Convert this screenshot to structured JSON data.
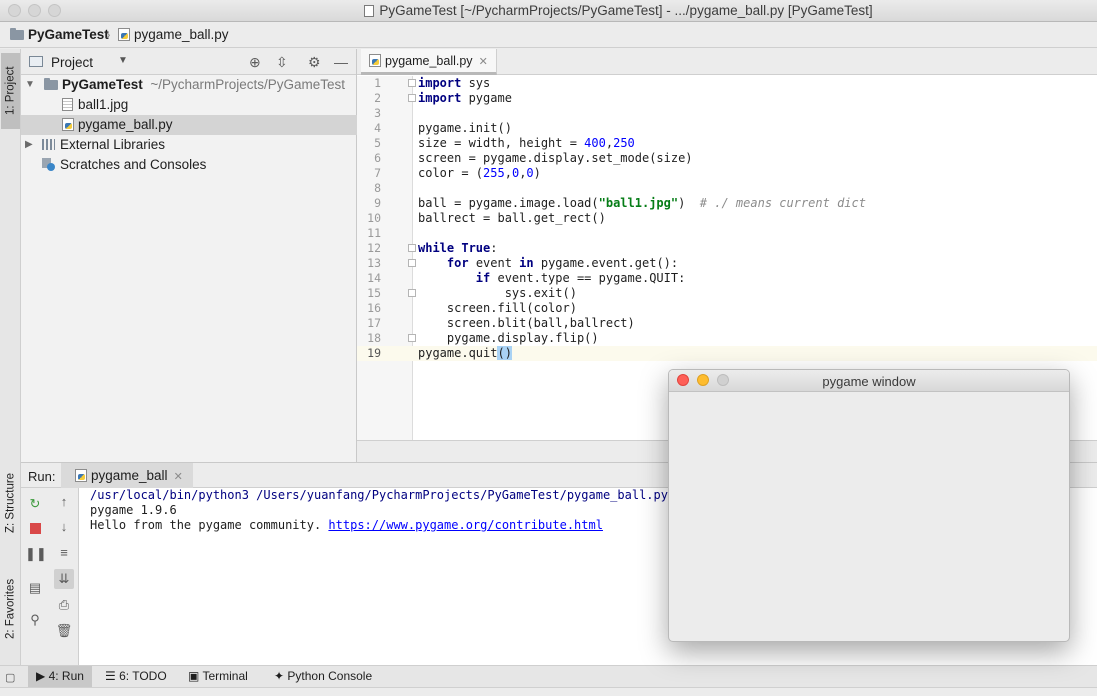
{
  "window": {
    "title": "PyGameTest [~/PycharmProjects/PyGameTest] - .../pygame_ball.py [PyGameTest]"
  },
  "navbar": {
    "project": "PyGameTest",
    "file": "pygame_ball.py"
  },
  "left_stripe": {
    "project_tab": "1: Project",
    "structure_tab": "Z: Structure",
    "favorites_tab": "2: Favorites"
  },
  "project_panel": {
    "header": "Project",
    "root_name": "PyGameTest",
    "root_path": "~/PycharmProjects/PyGameTest",
    "files": [
      "ball1.jpg",
      "pygame_ball.py"
    ],
    "external": "External Libraries",
    "scratches": "Scratches and Consoles"
  },
  "editor": {
    "tab": "pygame_ball.py",
    "line_numbers": [
      "1",
      "2",
      "3",
      "4",
      "5",
      "6",
      "7",
      "8",
      "9",
      "10",
      "11",
      "12",
      "13",
      "14",
      "15",
      "16",
      "17",
      "18",
      "19"
    ]
  },
  "run": {
    "label": "Run:",
    "tab": "pygame_ball",
    "console": {
      "cmd": "/usr/local/bin/python3 /Users/yuanfang/PycharmProjects/PyGameTest/pygame_ball.py",
      "version": "pygame 1.9.6",
      "hello": "Hello from the pygame community. ",
      "link": "https://www.pygame.org/contribute.html"
    }
  },
  "bottom_tabs": {
    "run": "4: Run",
    "todo": "6: TODO",
    "terminal": "Terminal",
    "python_console": "Python Console"
  },
  "pygame_window": {
    "title": "pygame window"
  },
  "colors": {
    "close": "#fe5f57",
    "minimize": "#febc2e",
    "disabled": "#d0d0d0",
    "keyword": "#000080",
    "number": "#0000ff",
    "string": "#067d17"
  }
}
